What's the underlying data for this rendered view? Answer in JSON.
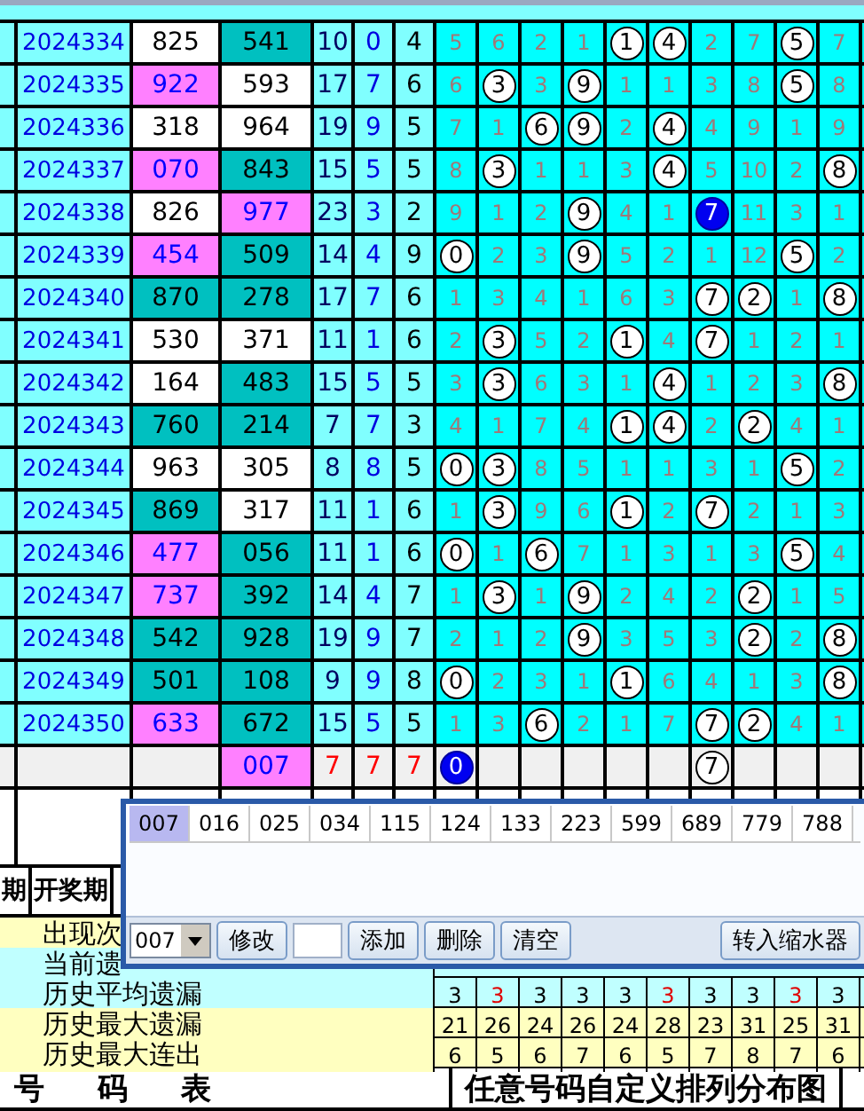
{
  "rows": [
    {
      "period": "2024334",
      "first": {
        "value": "825",
        "color": "#ffffff"
      },
      "second": {
        "value": "541",
        "color": "#00c0c0"
      },
      "sum": "10",
      "span": "0",
      "tail": "4",
      "cells": [
        {
          "kind": "miss",
          "text": "5"
        },
        {
          "kind": "miss",
          "text": "6"
        },
        {
          "kind": "miss",
          "text": "2"
        },
        {
          "kind": "miss",
          "text": "1"
        },
        {
          "kind": "hit",
          "text": "1"
        },
        {
          "kind": "hit",
          "text": "4"
        },
        {
          "kind": "miss",
          "text": "2"
        },
        {
          "kind": "miss",
          "text": "7"
        },
        {
          "kind": "hit",
          "text": "5"
        },
        {
          "kind": "miss",
          "text": "7"
        }
      ]
    },
    {
      "period": "2024335",
      "first": {
        "value": "922",
        "color": "#ff80ff"
      },
      "second": {
        "value": "593",
        "color": "#ffffff"
      },
      "sum": "17",
      "span": "7",
      "tail": "6",
      "cells": [
        {
          "kind": "miss",
          "text": "6"
        },
        {
          "kind": "hit",
          "text": "3"
        },
        {
          "kind": "miss",
          "text": "3"
        },
        {
          "kind": "hit",
          "text": "9"
        },
        {
          "kind": "miss",
          "text": "1"
        },
        {
          "kind": "miss",
          "text": "1"
        },
        {
          "kind": "miss",
          "text": "3"
        },
        {
          "kind": "miss",
          "text": "8"
        },
        {
          "kind": "hit",
          "text": "5"
        },
        {
          "kind": "miss",
          "text": "8"
        }
      ]
    },
    {
      "period": "2024336",
      "first": {
        "value": "318",
        "color": "#ffffff"
      },
      "second": {
        "value": "964",
        "color": "#ffffff"
      },
      "sum": "19",
      "span": "9",
      "tail": "5",
      "cells": [
        {
          "kind": "miss",
          "text": "7"
        },
        {
          "kind": "miss",
          "text": "1"
        },
        {
          "kind": "hit",
          "text": "6"
        },
        {
          "kind": "hit",
          "text": "9"
        },
        {
          "kind": "miss",
          "text": "2"
        },
        {
          "kind": "hit",
          "text": "4"
        },
        {
          "kind": "miss",
          "text": "4"
        },
        {
          "kind": "miss",
          "text": "9"
        },
        {
          "kind": "miss",
          "text": "1"
        },
        {
          "kind": "miss",
          "text": "9"
        }
      ]
    },
    {
      "period": "2024337",
      "first": {
        "value": "070",
        "color": "#ff80ff"
      },
      "second": {
        "value": "843",
        "color": "#00c0c0"
      },
      "sum": "15",
      "span": "5",
      "tail": "5",
      "cells": [
        {
          "kind": "miss",
          "text": "8"
        },
        {
          "kind": "hit",
          "text": "3"
        },
        {
          "kind": "miss",
          "text": "1"
        },
        {
          "kind": "miss",
          "text": "1"
        },
        {
          "kind": "miss",
          "text": "3"
        },
        {
          "kind": "hit",
          "text": "4"
        },
        {
          "kind": "miss",
          "text": "5"
        },
        {
          "kind": "miss",
          "text": "10"
        },
        {
          "kind": "miss",
          "text": "2"
        },
        {
          "kind": "hit",
          "text": "8"
        }
      ]
    },
    {
      "period": "2024338",
      "first": {
        "value": "826",
        "color": "#ffffff"
      },
      "second": {
        "value": "977",
        "color": "#ff80ff"
      },
      "sum": "23",
      "span": "3",
      "tail": "2",
      "cells": [
        {
          "kind": "miss",
          "text": "9"
        },
        {
          "kind": "miss",
          "text": "1"
        },
        {
          "kind": "miss",
          "text": "2"
        },
        {
          "kind": "hit",
          "text": "9"
        },
        {
          "kind": "miss",
          "text": "4"
        },
        {
          "kind": "miss",
          "text": "1"
        },
        {
          "kind": "latest",
          "text": "7"
        },
        {
          "kind": "miss",
          "text": "11"
        },
        {
          "kind": "miss",
          "text": "3"
        },
        {
          "kind": "miss",
          "text": "1"
        }
      ]
    },
    {
      "period": "2024339",
      "first": {
        "value": "454",
        "color": "#ff80ff"
      },
      "second": {
        "value": "509",
        "color": "#00c0c0"
      },
      "sum": "14",
      "span": "4",
      "tail": "9",
      "cells": [
        {
          "kind": "hit",
          "text": "0"
        },
        {
          "kind": "miss",
          "text": "2"
        },
        {
          "kind": "miss",
          "text": "3"
        },
        {
          "kind": "hit",
          "text": "9"
        },
        {
          "kind": "miss",
          "text": "5"
        },
        {
          "kind": "miss",
          "text": "2"
        },
        {
          "kind": "miss",
          "text": "1"
        },
        {
          "kind": "miss",
          "text": "12"
        },
        {
          "kind": "hit",
          "text": "5"
        },
        {
          "kind": "miss",
          "text": "2"
        }
      ]
    },
    {
      "period": "2024340",
      "first": {
        "value": "870",
        "color": "#00c0c0"
      },
      "second": {
        "value": "278",
        "color": "#00c0c0"
      },
      "sum": "17",
      "span": "7",
      "tail": "6",
      "cells": [
        {
          "kind": "miss",
          "text": "1"
        },
        {
          "kind": "miss",
          "text": "3"
        },
        {
          "kind": "miss",
          "text": "4"
        },
        {
          "kind": "miss",
          "text": "1"
        },
        {
          "kind": "miss",
          "text": "6"
        },
        {
          "kind": "miss",
          "text": "3"
        },
        {
          "kind": "hit",
          "text": "7"
        },
        {
          "kind": "hit",
          "text": "2"
        },
        {
          "kind": "miss",
          "text": "1"
        },
        {
          "kind": "hit",
          "text": "8"
        }
      ]
    },
    {
      "period": "2024341",
      "first": {
        "value": "530",
        "color": "#ffffff"
      },
      "second": {
        "value": "371",
        "color": "#ffffff"
      },
      "sum": "11",
      "span": "1",
      "tail": "6",
      "cells": [
        {
          "kind": "miss",
          "text": "2"
        },
        {
          "kind": "hit",
          "text": "3"
        },
        {
          "kind": "miss",
          "text": "5"
        },
        {
          "kind": "miss",
          "text": "2"
        },
        {
          "kind": "hit",
          "text": "1"
        },
        {
          "kind": "miss",
          "text": "4"
        },
        {
          "kind": "hit",
          "text": "7"
        },
        {
          "kind": "miss",
          "text": "1"
        },
        {
          "kind": "miss",
          "text": "2"
        },
        {
          "kind": "miss",
          "text": "1"
        }
      ]
    },
    {
      "period": "2024342",
      "first": {
        "value": "164",
        "color": "#ffffff"
      },
      "second": {
        "value": "483",
        "color": "#00c0c0"
      },
      "sum": "15",
      "span": "5",
      "tail": "5",
      "cells": [
        {
          "kind": "miss",
          "text": "3"
        },
        {
          "kind": "hit",
          "text": "3"
        },
        {
          "kind": "miss",
          "text": "6"
        },
        {
          "kind": "miss",
          "text": "3"
        },
        {
          "kind": "miss",
          "text": "1"
        },
        {
          "kind": "hit",
          "text": "4"
        },
        {
          "kind": "miss",
          "text": "1"
        },
        {
          "kind": "miss",
          "text": "2"
        },
        {
          "kind": "miss",
          "text": "3"
        },
        {
          "kind": "hit",
          "text": "8"
        }
      ]
    },
    {
      "period": "2024343",
      "first": {
        "value": "760",
        "color": "#00c0c0"
      },
      "second": {
        "value": "214",
        "color": "#00c0c0"
      },
      "sum": "7",
      "span": "7",
      "tail": "3",
      "cells": [
        {
          "kind": "miss",
          "text": "4"
        },
        {
          "kind": "miss",
          "text": "1"
        },
        {
          "kind": "miss",
          "text": "7"
        },
        {
          "kind": "miss",
          "text": "4"
        },
        {
          "kind": "hit",
          "text": "1"
        },
        {
          "kind": "hit",
          "text": "4"
        },
        {
          "kind": "miss",
          "text": "2"
        },
        {
          "kind": "hit",
          "text": "2"
        },
        {
          "kind": "miss",
          "text": "4"
        },
        {
          "kind": "miss",
          "text": "1"
        }
      ]
    },
    {
      "period": "2024344",
      "first": {
        "value": "963",
        "color": "#ffffff"
      },
      "second": {
        "value": "305",
        "color": "#ffffff"
      },
      "sum": "8",
      "span": "8",
      "tail": "5",
      "cells": [
        {
          "kind": "hit",
          "text": "0"
        },
        {
          "kind": "hit",
          "text": "3"
        },
        {
          "kind": "miss",
          "text": "8"
        },
        {
          "kind": "miss",
          "text": "5"
        },
        {
          "kind": "miss",
          "text": "1"
        },
        {
          "kind": "miss",
          "text": "1"
        },
        {
          "kind": "miss",
          "text": "3"
        },
        {
          "kind": "miss",
          "text": "1"
        },
        {
          "kind": "hit",
          "text": "5"
        },
        {
          "kind": "miss",
          "text": "2"
        }
      ]
    },
    {
      "period": "2024345",
      "first": {
        "value": "869",
        "color": "#00c0c0"
      },
      "second": {
        "value": "317",
        "color": "#ffffff"
      },
      "sum": "11",
      "span": "1",
      "tail": "6",
      "cells": [
        {
          "kind": "miss",
          "text": "1"
        },
        {
          "kind": "hit",
          "text": "3"
        },
        {
          "kind": "miss",
          "text": "9"
        },
        {
          "kind": "miss",
          "text": "6"
        },
        {
          "kind": "hit",
          "text": "1"
        },
        {
          "kind": "miss",
          "text": "2"
        },
        {
          "kind": "hit",
          "text": "7"
        },
        {
          "kind": "miss",
          "text": "2"
        },
        {
          "kind": "miss",
          "text": "1"
        },
        {
          "kind": "miss",
          "text": "3"
        }
      ]
    },
    {
      "period": "2024346",
      "first": {
        "value": "477",
        "color": "#ff80ff"
      },
      "second": {
        "value": "056",
        "color": "#00c0c0"
      },
      "sum": "11",
      "span": "1",
      "tail": "6",
      "cells": [
        {
          "kind": "hit",
          "text": "0"
        },
        {
          "kind": "miss",
          "text": "1"
        },
        {
          "kind": "hit",
          "text": "6"
        },
        {
          "kind": "miss",
          "text": "7"
        },
        {
          "kind": "miss",
          "text": "1"
        },
        {
          "kind": "miss",
          "text": "3"
        },
        {
          "kind": "miss",
          "text": "1"
        },
        {
          "kind": "miss",
          "text": "3"
        },
        {
          "kind": "hit",
          "text": "5"
        },
        {
          "kind": "miss",
          "text": "4"
        }
      ]
    },
    {
      "period": "2024347",
      "first": {
        "value": "737",
        "color": "#ff80ff"
      },
      "second": {
        "value": "392",
        "color": "#00c0c0"
      },
      "sum": "14",
      "span": "4",
      "tail": "7",
      "cells": [
        {
          "kind": "miss",
          "text": "1"
        },
        {
          "kind": "hit",
          "text": "3"
        },
        {
          "kind": "miss",
          "text": "1"
        },
        {
          "kind": "hit",
          "text": "9"
        },
        {
          "kind": "miss",
          "text": "2"
        },
        {
          "kind": "miss",
          "text": "4"
        },
        {
          "kind": "miss",
          "text": "2"
        },
        {
          "kind": "hit",
          "text": "2"
        },
        {
          "kind": "miss",
          "text": "1"
        },
        {
          "kind": "miss",
          "text": "5"
        }
      ]
    },
    {
      "period": "2024348",
      "first": {
        "value": "542",
        "color": "#00c0c0"
      },
      "second": {
        "value": "928",
        "color": "#00c0c0"
      },
      "sum": "19",
      "span": "9",
      "tail": "7",
      "cells": [
        {
          "kind": "miss",
          "text": "2"
        },
        {
          "kind": "miss",
          "text": "1"
        },
        {
          "kind": "miss",
          "text": "2"
        },
        {
          "kind": "hit",
          "text": "9"
        },
        {
          "kind": "miss",
          "text": "3"
        },
        {
          "kind": "miss",
          "text": "5"
        },
        {
          "kind": "miss",
          "text": "3"
        },
        {
          "kind": "hit",
          "text": "2"
        },
        {
          "kind": "miss",
          "text": "2"
        },
        {
          "kind": "hit",
          "text": "8"
        }
      ]
    },
    {
      "period": "2024349",
      "first": {
        "value": "501",
        "color": "#00c0c0"
      },
      "second": {
        "value": "108",
        "color": "#00c0c0"
      },
      "sum": "9",
      "span": "9",
      "tail": "8",
      "cells": [
        {
          "kind": "hit",
          "text": "0"
        },
        {
          "kind": "miss",
          "text": "2"
        },
        {
          "kind": "miss",
          "text": "3"
        },
        {
          "kind": "miss",
          "text": "1"
        },
        {
          "kind": "hit",
          "text": "1"
        },
        {
          "kind": "miss",
          "text": "6"
        },
        {
          "kind": "miss",
          "text": "4"
        },
        {
          "kind": "miss",
          "text": "1"
        },
        {
          "kind": "miss",
          "text": "3"
        },
        {
          "kind": "hit",
          "text": "8"
        }
      ]
    },
    {
      "period": "2024350",
      "first": {
        "value": "633",
        "color": "#ff80ff"
      },
      "second": {
        "value": "672",
        "color": "#00c0c0"
      },
      "sum": "15",
      "span": "5",
      "tail": "5",
      "cells": [
        {
          "kind": "miss",
          "text": "1"
        },
        {
          "kind": "miss",
          "text": "3"
        },
        {
          "kind": "hit",
          "text": "6"
        },
        {
          "kind": "miss",
          "text": "2"
        },
        {
          "kind": "miss",
          "text": "1"
        },
        {
          "kind": "miss",
          "text": "7"
        },
        {
          "kind": "hit",
          "text": "7"
        },
        {
          "kind": "hit",
          "text": "2"
        },
        {
          "kind": "miss",
          "text": "4"
        },
        {
          "kind": "miss",
          "text": "1"
        }
      ]
    }
  ],
  "forecast": {
    "second": {
      "value": "007",
      "color": "#ff80ff"
    },
    "sum": "7",
    "span": "7",
    "tail": "7",
    "cells": [
      {
        "kind": "latest",
        "text": "0"
      },
      {
        "kind": "empty"
      },
      {
        "kind": "empty"
      },
      {
        "kind": "empty"
      },
      {
        "kind": "empty"
      },
      {
        "kind": "empty"
      },
      {
        "kind": "hit",
        "text": "7"
      },
      {
        "kind": "empty"
      },
      {
        "kind": "empty"
      },
      {
        "kind": "empty"
      }
    ]
  },
  "header": {
    "column_1": "期",
    "column_2": "开奖期"
  },
  "stats": [
    {
      "label": "出现次",
      "color": "#ffffc0"
    },
    {
      "label": "当前遗",
      "color": "#c0ffff"
    },
    {
      "label": "历史平均遗漏",
      "color": "#c0ffff",
      "values": [
        {
          "text": "3",
          "highlight": false
        },
        {
          "text": "3",
          "highlight": true
        },
        {
          "text": "3",
          "highlight": false
        },
        {
          "text": "3",
          "highlight": false
        },
        {
          "text": "3",
          "highlight": false
        },
        {
          "text": "3",
          "highlight": true
        },
        {
          "text": "3",
          "highlight": false
        },
        {
          "text": "3",
          "highlight": false
        },
        {
          "text": "3",
          "highlight": true
        },
        {
          "text": "3",
          "highlight": false
        }
      ]
    },
    {
      "label": "历史最大遗漏",
      "color": "#ffffc0",
      "values": [
        {
          "text": "21",
          "highlight": false
        },
        {
          "text": "26",
          "highlight": false
        },
        {
          "text": "24",
          "highlight": false
        },
        {
          "text": "26",
          "highlight": false
        },
        {
          "text": "24",
          "highlight": false
        },
        {
          "text": "28",
          "highlight": false
        },
        {
          "text": "23",
          "highlight": false
        },
        {
          "text": "31",
          "highlight": false
        },
        {
          "text": "25",
          "highlight": false
        },
        {
          "text": "31",
          "highlight": false
        }
      ]
    },
    {
      "label": "历史最大连出",
      "color": "#ffffc0",
      "values": [
        {
          "text": "6",
          "highlight": false
        },
        {
          "text": "5",
          "highlight": false
        },
        {
          "text": "6",
          "highlight": false
        },
        {
          "text": "7",
          "highlight": false
        },
        {
          "text": "6",
          "highlight": false
        },
        {
          "text": "5",
          "highlight": false
        },
        {
          "text": "7",
          "highlight": false
        },
        {
          "text": "8",
          "highlight": false
        },
        {
          "text": "7",
          "highlight": false
        },
        {
          "text": "6",
          "highlight": false
        }
      ]
    }
  ],
  "footer": {
    "left": "号 码 表",
    "right": "任意号码自定义排列分布图"
  },
  "picker": {
    "chips": [
      {
        "text": "007",
        "selected": true
      },
      {
        "text": "016",
        "selected": false
      },
      {
        "text": "025",
        "selected": false
      },
      {
        "text": "034",
        "selected": false
      },
      {
        "text": "115",
        "selected": false
      },
      {
        "text": "124",
        "selected": false
      },
      {
        "text": "133",
        "selected": false
      },
      {
        "text": "223",
        "selected": false
      },
      {
        "text": "599",
        "selected": false
      },
      {
        "text": "689",
        "selected": false
      },
      {
        "text": "779",
        "selected": false
      },
      {
        "text": "788",
        "selected": false
      }
    ],
    "combo": "007",
    "buttons": [
      "修改",
      "添加",
      "删除",
      "清空"
    ],
    "transfer": "转入缩水器"
  }
}
